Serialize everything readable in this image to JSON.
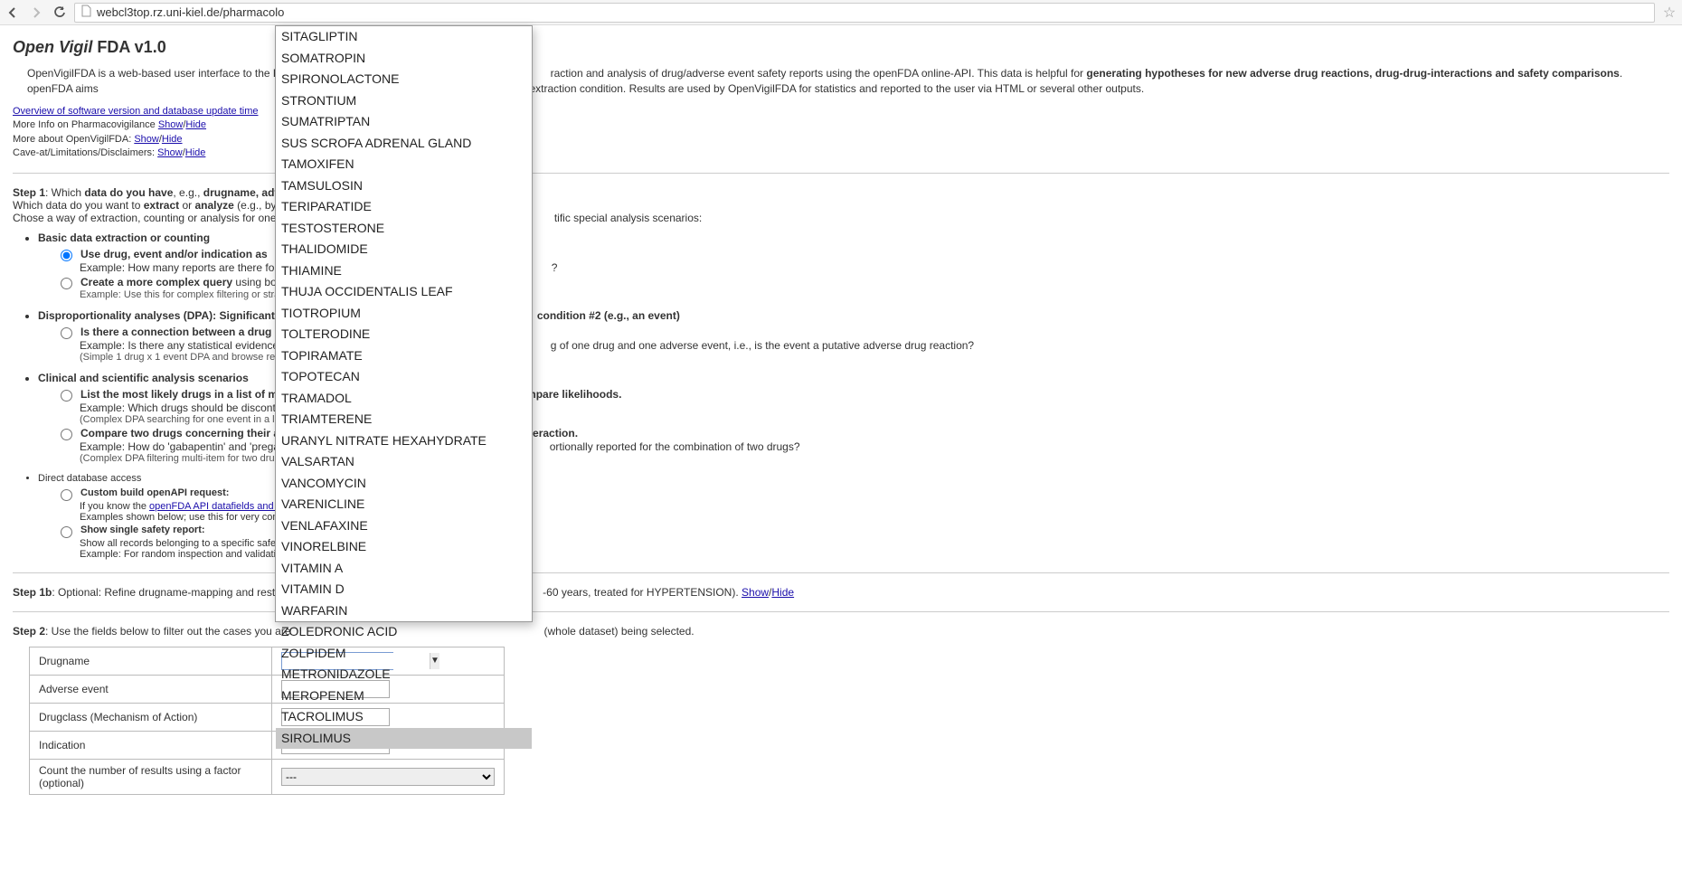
{
  "browser": {
    "url": "webcl3top.rz.uni-kiel.de/pharmacolo"
  },
  "title": {
    "italic": "Open Vigil",
    "rest": " FDA v1.0"
  },
  "intro": {
    "lead": "OpenVigilFDA is a web-based user interface to the FDA ",
    "mid1": "raction and analysis of drug/adverse event safety reports using the openFDA online-API. This data is helpful for ",
    "bold1": "generating hypotheses for new adverse drug reactions, drug-drug-interactions and safety comparisons",
    "mid2": ". openFDA aims",
    "tail": " AERS and can count reports stratified to an extraction condition. Results are used by OpenVigilFDA for statistics and reported to the user via HTML or several other outputs."
  },
  "info_links": {
    "overview": "Overview of software version and database update time",
    "pharm_label": "More Info on Pharmacovigilance ",
    "show": "Show",
    "hide": "Hide",
    "about_label": "More about OpenVigilFDA: ",
    "caveat_label": "Cave-at/Limitations/Disclaimers: "
  },
  "step1": {
    "label": "Step 1",
    "which": ": Which ",
    "bold1": "data do you have",
    "eg": ", e.g., ",
    "bold2": "drugname, adve",
    "line2a": "Which data do you want to ",
    "bold3": "extract",
    "or": " or ",
    "bold4": "analyze",
    "line2b": " (e.g., by co",
    "line3a": "Chose a way of extraction, counting or analysis for one or m",
    "line3b": "tific special analysis scenarios:"
  },
  "basic": {
    "head": "Basic data extraction or counting",
    "opt1_label": "Use drug, event and/or indication as ",
    "opt1_ex_a": "Example: How many reports are there for 'me",
    "opt1_ex_b": "?",
    "opt2_label": "Create a more complex query",
    "opt2_after": " using boolean lo",
    "opt2_ex": "Example: Use this for complex filtering or stratification"
  },
  "dpa": {
    "head_a": "Disproportionality analyses (DPA): Significant a",
    "head_b": "condition #2 (e.g., an event)",
    "opt1_label": "Is there a connection between a drug",
    "opt1_ex_a": "Example: Is there any statistical evidence for ",
    "opt1_ex_b": "g of one drug and one adverse event, i.e., is the event a putative adverse drug reaction?",
    "opt1_note": "(Simple 1 drug x 1 event DPA and browse results)"
  },
  "clinical": {
    "head": "Clinical and scientific analysis scenarios",
    "opt1_label_a": "List the most likely drugs in a list of m",
    "opt1_label_b": "mpare likelihoods.",
    "opt1_ex": "Example: Which drugs should be discontinued",
    "opt1_note": "(Complex DPA searching for one event in a list of drug",
    "opt2_label_a": "Compare two drugs concerning their a",
    "opt2_label_b": "eraction.",
    "opt2_ex_a": "Example: How do 'gabapentin' and 'pregabali",
    "opt2_ex_b": "ortionally reported for the combination of two drugs?",
    "opt2_note": "(Complex DPA filtering multi-item for two drugs, alone/"
  },
  "dda": {
    "head": "Direct database access",
    "opt1_label": "Custom build openAPI request:",
    "opt1_line_a": "If you know the ",
    "opt1_link": "openFDA API datafields and query synt",
    "opt1_line_b": "Examples shown below; use this for very complicated c",
    "opt2_label": "Show single safety report:",
    "opt2_line": "Show all records belonging to a specific safety report ic",
    "opt2_ex": "Example: For random inspection and validation of prev"
  },
  "step1b": {
    "label": "Step 1b",
    "text_a": ": Optional: Refine drugname-mapping and restrict",
    "text_b": "-60 years, treated for HYPERTENSION). ",
    "show": "Show",
    "hide": "Hide"
  },
  "step2": {
    "label": "Step 2",
    "text_a": ": Use the fields below to filter out the cases you are",
    "text_b": "(whole dataset) being selected."
  },
  "form": {
    "drugname": "Drugname",
    "adverse": "Adverse event",
    "drugclass": "Drugclass (Mechanism of Action)",
    "indication": "Indication",
    "count": "Count the number of results using a factor (optional)",
    "count_default": "---"
  },
  "dropdown": {
    "items": [
      "SITAGLIPTIN",
      "SOMATROPIN",
      "SPIRONOLACTONE",
      "STRONTIUM",
      "SUMATRIPTAN",
      "SUS SCROFA ADRENAL GLAND",
      "TAMOXIFEN",
      "TAMSULOSIN",
      "TERIPARATIDE",
      "TESTOSTERONE",
      "THALIDOMIDE",
      "THIAMINE",
      "THUJA OCCIDENTALIS LEAF",
      "TIOTROPIUM",
      "TOLTERODINE",
      "TOPIRAMATE",
      "TOPOTECAN",
      "TRAMADOL",
      "TRIAMTERENE",
      "URANYL NITRATE HEXAHYDRATE",
      "VALSARTAN",
      "VANCOMYCIN",
      "VARENICLINE",
      "VENLAFAXINE",
      "VINORELBINE",
      "VITAMIN A",
      "VITAMIN D",
      "WARFARIN",
      "ZOLEDRONIC ACID",
      "ZOLPIDEM",
      "METRONIDAZOLE",
      "MEROPENEM",
      "TACROLIMUS",
      "SIROLIMUS"
    ],
    "highlight_index": 33
  }
}
